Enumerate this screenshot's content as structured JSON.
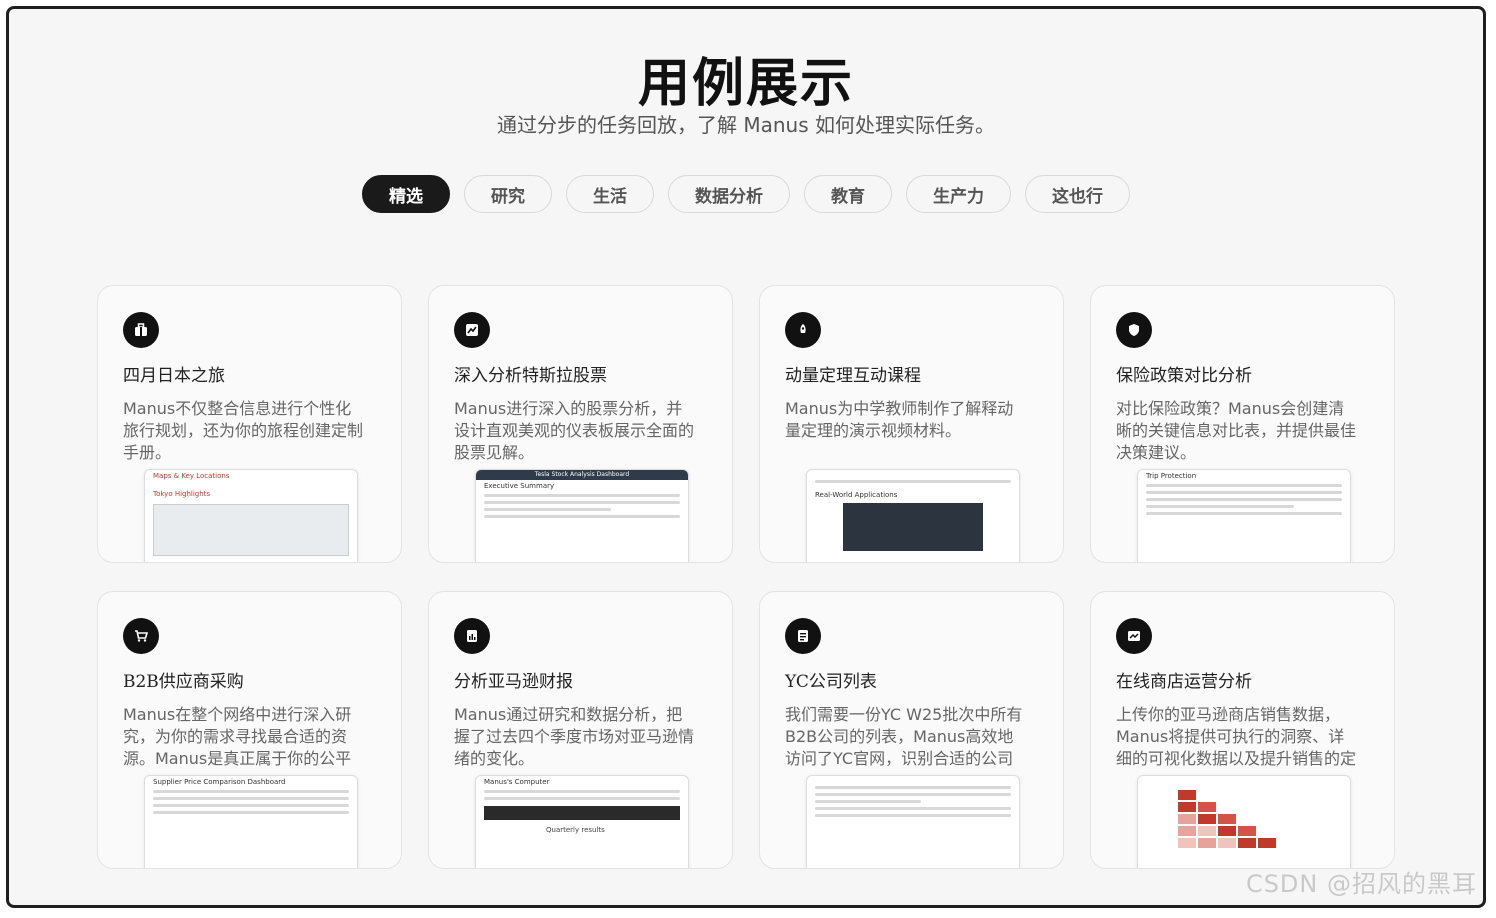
{
  "header": {
    "title": "用例展示",
    "subtitle": "通过分步的任务回放，了解 Manus 如何处理实际任务。"
  },
  "tabs": [
    {
      "label": "精选",
      "active": true
    },
    {
      "label": "研究",
      "active": false
    },
    {
      "label": "生活",
      "active": false
    },
    {
      "label": "数据分析",
      "active": false
    },
    {
      "label": "教育",
      "active": false
    },
    {
      "label": "生产力",
      "active": false
    },
    {
      "label": "这也行",
      "active": false
    }
  ],
  "cards": [
    {
      "icon": "suitcase-icon",
      "title": "四月日本之旅",
      "desc": "Manus不仅整合信息进行个性化旅行规划，还为你的旅程创建定制手册。",
      "preview_heading": "Maps & Key Locations",
      "preview_sub": "Tokyo Highlights"
    },
    {
      "icon": "chart-icon",
      "title": "深入分析特斯拉股票",
      "desc": "Manus进行深入的股票分析，并设计直观美观的仪表板展示全面的股票见解。",
      "preview_heading": "Tesla Stock Analysis Dashboard",
      "preview_sub": "Executive Summary"
    },
    {
      "icon": "rocket-icon",
      "title": "动量定理互动课程",
      "desc": "Manus为中学教师制作了解释动量定理的演示视频材料。",
      "preview_heading": "Real-World Applications",
      "preview_sub": ""
    },
    {
      "icon": "shield-icon",
      "title": "保险政策对比分析",
      "desc": "对比保险政策？Manus会创建清晰的关键信息对比表，并提供最佳决策建议。",
      "preview_heading": "Trip Protection",
      "preview_sub": ""
    },
    {
      "icon": "cart-icon",
      "title": "B2B供应商采购",
      "desc": "Manus在整个网络中进行深入研究，为你的需求寻找最合适的资源。Manus是真正属于你的公平代理。",
      "preview_heading": "Supplier Price Comparison Dashboard",
      "preview_sub": ""
    },
    {
      "icon": "report-icon",
      "title": "分析亚马逊财报",
      "desc": "Manus通过研究和数据分析，把握了过去四个季度市场对亚马逊情绪的变化。",
      "preview_heading": "Manus's Computer",
      "preview_sub": "Quarterly results"
    },
    {
      "icon": "list-icon",
      "title": "YC公司列表",
      "desc": "我们需要一份YC W25批次中所有B2B公司的列表，Manus高效地访问了YC官网，识别合适的公司并将其整理成表格。",
      "preview_heading": "",
      "preview_sub": ""
    },
    {
      "icon": "store-icon",
      "title": "在线商店运营分析",
      "desc": "上传你的亚马逊商店销售数据，Manus将提供可执行的洞察、详细的可视化数据以及提升销售的定制策略。",
      "preview_heading": "",
      "preview_sub": ""
    }
  ],
  "watermark": "CSDN @招风的黑耳"
}
